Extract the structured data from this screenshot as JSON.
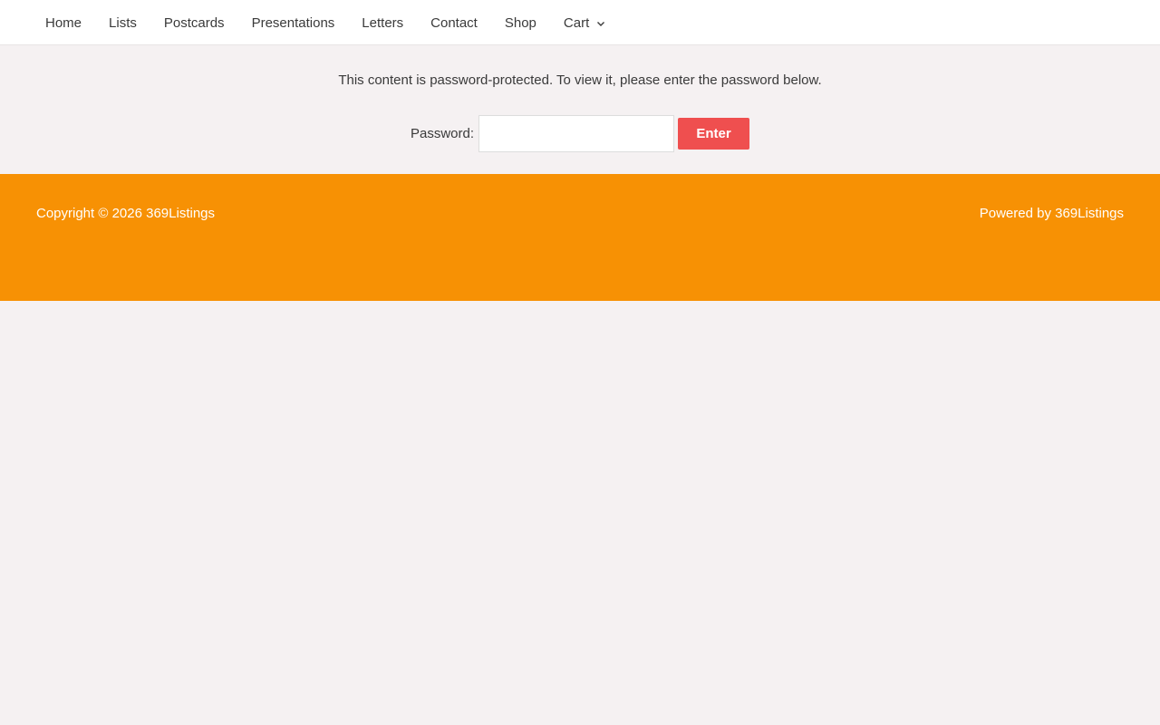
{
  "nav": {
    "items": [
      {
        "label": "Home"
      },
      {
        "label": "Lists"
      },
      {
        "label": "Postcards"
      },
      {
        "label": "Presentations"
      },
      {
        "label": "Letters"
      },
      {
        "label": "Contact"
      },
      {
        "label": "Shop"
      },
      {
        "label": "Cart",
        "icon": "chevron-down-icon"
      }
    ]
  },
  "content": {
    "message": "This content is password-protected. To view it, please enter the password below.",
    "password_label": "Password:",
    "password_value": "",
    "enter_label": "Enter",
    "button_color": "#ef4f4f"
  },
  "footer": {
    "copyright": "Copyright © 2026 369Listings",
    "powered": "Powered by 369Listings",
    "background_color": "#f79104"
  }
}
